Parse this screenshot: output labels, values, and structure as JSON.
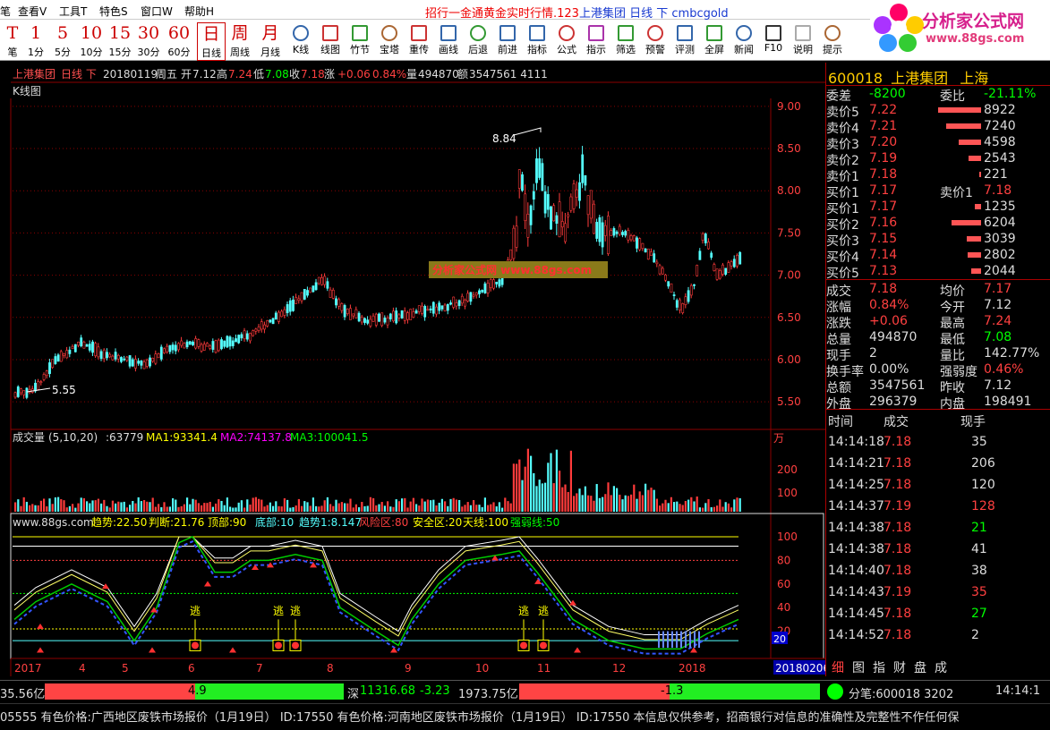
{
  "menubar": {
    "items": [
      "笔",
      "查看V",
      "工具T",
      "特色S",
      "窗口W",
      "帮助H"
    ],
    "title_red": "招行一金通黄金实时行情.123",
    "title_stock": "上港集团",
    "title_mode": "日线 下",
    "title_user": "cmbcgold"
  },
  "toolbar": {
    "periods": [
      {
        "big": "T",
        "label": "笔"
      },
      {
        "big": "1",
        "label": "1分"
      },
      {
        "big": "5",
        "label": "5分"
      },
      {
        "big": "10",
        "label": "10分"
      },
      {
        "big": "15",
        "label": "15分"
      },
      {
        "big": "30",
        "label": "30分"
      },
      {
        "big": "60",
        "label": "60分"
      },
      {
        "big": "日",
        "label": "日线"
      },
      {
        "big": "周",
        "label": "周线"
      },
      {
        "big": "月",
        "label": "月线"
      }
    ],
    "tools": [
      "K线",
      "线图",
      "竹节",
      "宝塔",
      "重传",
      "画线",
      "后退",
      "前进",
      "指标",
      "公式",
      "指示",
      "筛选",
      "预警",
      "评测",
      "全屏",
      "新闻",
      "F10",
      "说明",
      "提示"
    ]
  },
  "logo": {
    "name": "分析家公式网",
    "url": "www.88gs.com"
  },
  "kline": {
    "header": {
      "stock": "上港集团",
      "mode": "日线 下",
      "date": "20180119",
      "weekday": "周五",
      "open_label": "开",
      "open": "7.12",
      "high_label": "高",
      "high": "7.24",
      "low_label": "低",
      "low": "7.08",
      "close_label": "收",
      "close": "7.18",
      "chg_label": "涨",
      "chg": "+0.06",
      "pct": "0.84%",
      "vol_label": "量",
      "vol": "494870",
      "amt_label": "额",
      "amt": "3547561 4111"
    },
    "panel_title": "K线图",
    "max_label": "8.84",
    "min_label": "5.55",
    "watermark": "分析家公式网  www.88gs.com",
    "yticks": [
      "9.00",
      "8.50",
      "8.00",
      "7.50",
      "7.00",
      "6.50",
      "6.00",
      "5.50"
    ]
  },
  "volume": {
    "title": "成交量",
    "params": "(5,10,20)",
    "value": ":63779",
    "ma1": "MA1:93341.4",
    "ma2": "MA2:74137.8",
    "ma3": "MA3:100041.5",
    "unit": "万",
    "yticks": [
      "200",
      "100"
    ]
  },
  "indicator": {
    "site": "www.88gs.com",
    "trend": "趋势:22.50",
    "judge": "判断:21.76",
    "top": "顶部:90",
    "bottom": "底部:10",
    "trend_line": "趋势1:8.147",
    "risk": "风险区:80",
    "safe": "安全区:20",
    "sky": "天线:100",
    "strong": "强弱线:50",
    "escape_label": "逃",
    "current_value": "20",
    "yticks": [
      "100",
      "80",
      "60",
      "40",
      "20"
    ]
  },
  "xaxis": {
    "labels": [
      "2017",
      "4",
      "5",
      "6",
      "7",
      "8",
      "9",
      "10",
      "11",
      "12",
      "2018"
    ],
    "date_box": "20180206"
  },
  "quote": {
    "code": "600018",
    "name": "上港集团",
    "market": "上海",
    "weicha_label": "委差",
    "weicha": "-8200",
    "weibi_label": "委比",
    "weibi": "-21.11%",
    "asks": [
      {
        "label": "卖价5",
        "price": "7.22",
        "vol": "8922"
      },
      {
        "label": "卖价4",
        "price": "7.21",
        "vol": "7240"
      },
      {
        "label": "卖价3",
        "price": "7.20",
        "vol": "4598"
      },
      {
        "label": "卖价2",
        "price": "7.19",
        "vol": "2543"
      },
      {
        "label": "卖价1",
        "price": "7.18",
        "vol": "221"
      }
    ],
    "buy1_label": "买价1",
    "buy1": "7.17",
    "sell1_label": "卖价1",
    "sell1": "7.18",
    "bids": [
      {
        "label": "买价1",
        "price": "7.17",
        "vol": "1235"
      },
      {
        "label": "买价2",
        "price": "7.16",
        "vol": "6204"
      },
      {
        "label": "买价3",
        "price": "7.15",
        "vol": "3039"
      },
      {
        "label": "买价4",
        "price": "7.14",
        "vol": "2802"
      },
      {
        "label": "买价5",
        "price": "7.13",
        "vol": "2044"
      }
    ],
    "stats": [
      [
        "成交",
        "7.18",
        "均价",
        "7.17"
      ],
      [
        "涨幅",
        "0.84%",
        "今开",
        "7.12"
      ],
      [
        "涨跌",
        "+0.06",
        "最高",
        "7.24"
      ],
      [
        "总量",
        "494870",
        "最低",
        "7.08"
      ],
      [
        "现手",
        "2",
        "量比",
        "142.77%"
      ],
      [
        "换手率",
        "0.00%",
        "强弱度",
        "0.46%"
      ],
      [
        "总额",
        "3547561",
        "昨收",
        "7.12"
      ],
      [
        "外盘",
        "296379",
        "内盘",
        "198491"
      ]
    ],
    "trade_headers": [
      "时间",
      "成交",
      "现手"
    ],
    "trades": [
      [
        "14:14:18",
        "7.18",
        "35"
      ],
      [
        "14:14:21",
        "7.18",
        "206"
      ],
      [
        "14:14:25",
        "7.18",
        "120"
      ],
      [
        "14:14:37",
        "7.19",
        "128"
      ],
      [
        "14:14:38",
        "7.18",
        "21"
      ],
      [
        "14:14:38",
        "7.18",
        "41"
      ],
      [
        "14:14:40",
        "7.18",
        "38"
      ],
      [
        "14:14:43",
        "7.19",
        "35"
      ],
      [
        "14:14:45",
        "7.18",
        "27"
      ],
      [
        "14:14:52",
        "7.18",
        "2"
      ]
    ],
    "tabs": [
      "细",
      "图",
      "指",
      "财",
      "盘",
      "成"
    ]
  },
  "status": {
    "left_amt": "35.56亿",
    "sh_bar": "4.9",
    "sz_label": "深",
    "sz_index": "11316.68",
    "sz_chg": "-3.23",
    "sz_amt": "1973.75亿",
    "sz_bar": "-1.3",
    "fenbi": "分笔:600018 3202",
    "time": "14:14:1"
  },
  "ticker": {
    "text": "05555    有色价格:广西地区废铁市场报价（1月19日） ID:17550    有色价格:河南地区废铁市场报价（1月19日） ID:17550    本信息仅供参考，招商银行对信息的准确性及完整性不作任何保"
  },
  "colors": {
    "up": "#ff3b3b",
    "down": "#54ffff",
    "grid": "#8b0000",
    "white": "#ffffff",
    "yellow": "#ffff00",
    "magenta": "#ff00ff",
    "green": "#00ff00"
  }
}
